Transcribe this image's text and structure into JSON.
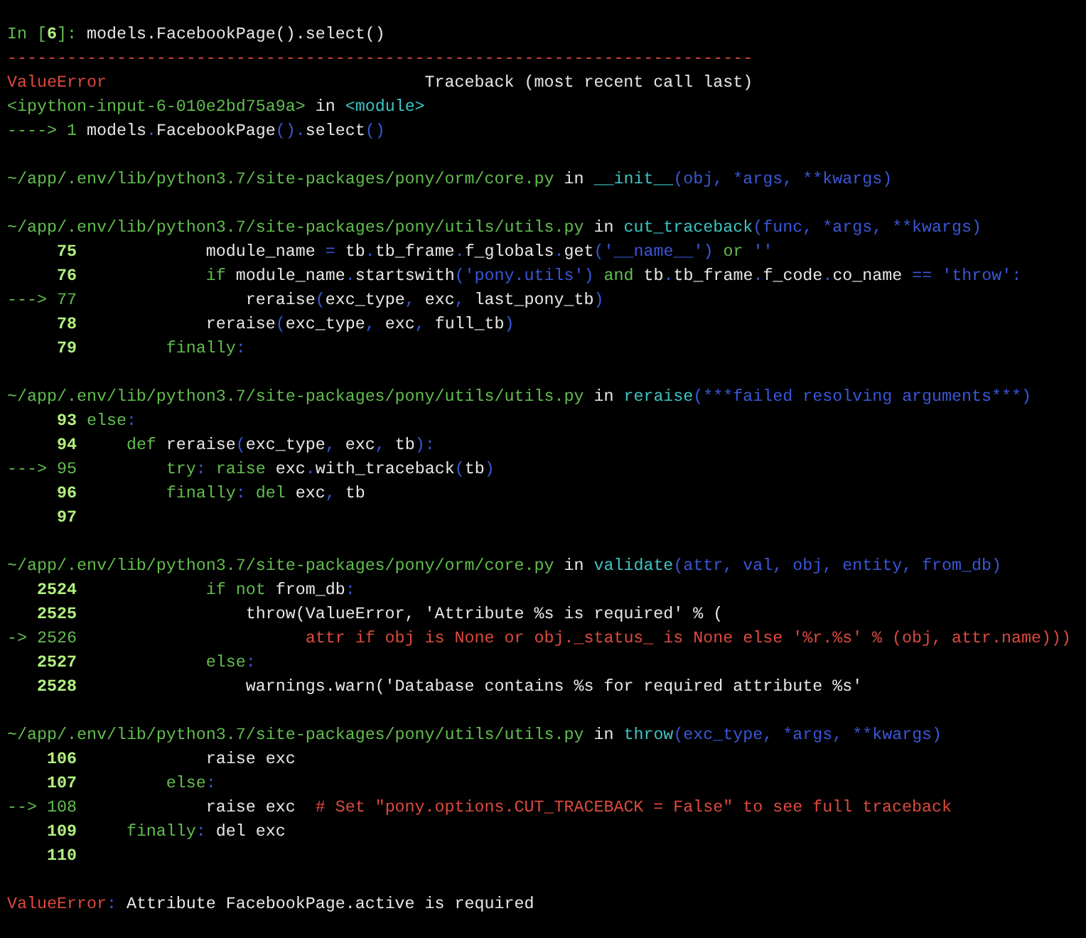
{
  "console": {
    "lines": [
      {
        "kind": "text",
        "segments": [
          {
            "kind": "green",
            "text": "In ["
          },
          {
            "kind": "num",
            "text": "6"
          },
          {
            "kind": "green",
            "text": "]: "
          },
          {
            "kind": "plain",
            "text": "models.FacebookPage().select()"
          }
        ]
      },
      {
        "kind": "text",
        "segments": [
          {
            "kind": "red",
            "text": "---------------------------------------------------------------------------"
          }
        ]
      },
      {
        "kind": "text",
        "segments": [
          {
            "kind": "red",
            "text": "ValueError"
          },
          {
            "kind": "plain",
            "text": "                                Traceback (most recent call last)"
          }
        ]
      },
      {
        "kind": "text",
        "segments": [
          {
            "kind": "green",
            "text": "<ipython-input-6-010e2bd75a9a>"
          },
          {
            "kind": "plain",
            "text": " in "
          },
          {
            "kind": "cyan",
            "text": "<module>"
          }
        ]
      },
      {
        "kind": "text",
        "segments": [
          {
            "kind": "green",
            "text": "----> 1 "
          },
          {
            "kind": "plain",
            "text": "models"
          },
          {
            "kind": "blue",
            "text": "."
          },
          {
            "kind": "plain",
            "text": "FacebookPage"
          },
          {
            "kind": "blue",
            "text": "()."
          },
          {
            "kind": "plain",
            "text": "select"
          },
          {
            "kind": "blue",
            "text": "()"
          }
        ]
      },
      {
        "kind": "blank"
      },
      {
        "kind": "text",
        "segments": [
          {
            "kind": "green",
            "text": "~/app/.env/lib/python3.7/site-packages/pony/orm/core.py"
          },
          {
            "kind": "plain",
            "text": " in "
          },
          {
            "kind": "cyan",
            "text": "__init__"
          },
          {
            "kind": "blue",
            "text": "(obj, *args, **kwargs)"
          }
        ]
      },
      {
        "kind": "blank"
      },
      {
        "kind": "text",
        "segments": [
          {
            "kind": "green",
            "text": "~/app/.env/lib/python3.7/site-packages/pony/utils/utils.py"
          },
          {
            "kind": "plain",
            "text": " in "
          },
          {
            "kind": "cyan",
            "text": "cut_traceback"
          },
          {
            "kind": "blue",
            "text": "(func, *args, **kwargs)"
          }
        ]
      },
      {
        "kind": "text",
        "segments": [
          {
            "kind": "num",
            "text": "     75"
          },
          {
            "kind": "plain",
            "text": "             module_name "
          },
          {
            "kind": "blue",
            "text": "="
          },
          {
            "kind": "plain",
            "text": " tb"
          },
          {
            "kind": "blue",
            "text": "."
          },
          {
            "kind": "plain",
            "text": "tb_frame"
          },
          {
            "kind": "blue",
            "text": "."
          },
          {
            "kind": "plain",
            "text": "f_globals"
          },
          {
            "kind": "blue",
            "text": "."
          },
          {
            "kind": "plain",
            "text": "get"
          },
          {
            "kind": "blue",
            "text": "('__name__')"
          },
          {
            "kind": "green",
            "text": " or "
          },
          {
            "kind": "blue",
            "text": "''"
          }
        ]
      },
      {
        "kind": "text",
        "segments": [
          {
            "kind": "num",
            "text": "     76"
          },
          {
            "kind": "green",
            "text": "             if"
          },
          {
            "kind": "plain",
            "text": " module_name"
          },
          {
            "kind": "blue",
            "text": "."
          },
          {
            "kind": "plain",
            "text": "startswith"
          },
          {
            "kind": "blue",
            "text": "('pony.utils')"
          },
          {
            "kind": "green",
            "text": " and"
          },
          {
            "kind": "plain",
            "text": " tb"
          },
          {
            "kind": "blue",
            "text": "."
          },
          {
            "kind": "plain",
            "text": "tb_frame"
          },
          {
            "kind": "blue",
            "text": "."
          },
          {
            "kind": "plain",
            "text": "f_code"
          },
          {
            "kind": "blue",
            "text": "."
          },
          {
            "kind": "plain",
            "text": "co_name "
          },
          {
            "kind": "blue",
            "text": "== 'throw':"
          }
        ]
      },
      {
        "kind": "text",
        "segments": [
          {
            "kind": "green",
            "text": "---> 77"
          },
          {
            "kind": "plain",
            "text": "                 reraise"
          },
          {
            "kind": "blue",
            "text": "("
          },
          {
            "kind": "plain",
            "text": "exc_type"
          },
          {
            "kind": "blue",
            "text": ","
          },
          {
            "kind": "plain",
            "text": " exc"
          },
          {
            "kind": "blue",
            "text": ","
          },
          {
            "kind": "plain",
            "text": " last_pony_tb"
          },
          {
            "kind": "blue",
            "text": ")"
          }
        ]
      },
      {
        "kind": "text",
        "segments": [
          {
            "kind": "num",
            "text": "     78"
          },
          {
            "kind": "plain",
            "text": "             reraise"
          },
          {
            "kind": "blue",
            "text": "("
          },
          {
            "kind": "plain",
            "text": "exc_type"
          },
          {
            "kind": "blue",
            "text": ","
          },
          {
            "kind": "plain",
            "text": " exc"
          },
          {
            "kind": "blue",
            "text": ","
          },
          {
            "kind": "plain",
            "text": " full_tb"
          },
          {
            "kind": "blue",
            "text": ")"
          }
        ]
      },
      {
        "kind": "text",
        "segments": [
          {
            "kind": "num",
            "text": "     79"
          },
          {
            "kind": "green",
            "text": "         finally"
          },
          {
            "kind": "blue",
            "text": ":"
          }
        ]
      },
      {
        "kind": "blank"
      },
      {
        "kind": "text",
        "segments": [
          {
            "kind": "green",
            "text": "~/app/.env/lib/python3.7/site-packages/pony/utils/utils.py"
          },
          {
            "kind": "plain",
            "text": " in "
          },
          {
            "kind": "cyan",
            "text": "reraise"
          },
          {
            "kind": "blue",
            "text": "(***failed resolving arguments***)"
          }
        ]
      },
      {
        "kind": "text",
        "segments": [
          {
            "kind": "num",
            "text": "     93"
          },
          {
            "kind": "green",
            "text": " else"
          },
          {
            "kind": "blue",
            "text": ":"
          }
        ]
      },
      {
        "kind": "text",
        "segments": [
          {
            "kind": "num",
            "text": "     94"
          },
          {
            "kind": "green",
            "text": "     def"
          },
          {
            "kind": "plain",
            "text": " reraise"
          },
          {
            "kind": "blue",
            "text": "("
          },
          {
            "kind": "plain",
            "text": "exc_type"
          },
          {
            "kind": "blue",
            "text": ","
          },
          {
            "kind": "plain",
            "text": " exc"
          },
          {
            "kind": "blue",
            "text": ","
          },
          {
            "kind": "plain",
            "text": " tb"
          },
          {
            "kind": "blue",
            "text": "):"
          }
        ]
      },
      {
        "kind": "text",
        "segments": [
          {
            "kind": "green",
            "text": "---> 95"
          },
          {
            "kind": "green",
            "text": "         try"
          },
          {
            "kind": "blue",
            "text": ":"
          },
          {
            "kind": "green",
            "text": " raise"
          },
          {
            "kind": "plain",
            "text": " exc"
          },
          {
            "kind": "blue",
            "text": "."
          },
          {
            "kind": "plain",
            "text": "with_traceback"
          },
          {
            "kind": "blue",
            "text": "("
          },
          {
            "kind": "plain",
            "text": "tb"
          },
          {
            "kind": "blue",
            "text": ")"
          }
        ]
      },
      {
        "kind": "text",
        "segments": [
          {
            "kind": "num",
            "text": "     96"
          },
          {
            "kind": "green",
            "text": "         finally"
          },
          {
            "kind": "blue",
            "text": ":"
          },
          {
            "kind": "green",
            "text": " del"
          },
          {
            "kind": "plain",
            "text": " exc"
          },
          {
            "kind": "blue",
            "text": ","
          },
          {
            "kind": "plain",
            "text": " tb"
          }
        ]
      },
      {
        "kind": "text",
        "segments": [
          {
            "kind": "num",
            "text": "     97"
          }
        ]
      },
      {
        "kind": "blank"
      },
      {
        "kind": "text",
        "segments": [
          {
            "kind": "green",
            "text": "~/app/.env/lib/python3.7/site-packages/pony/orm/core.py"
          },
          {
            "kind": "plain",
            "text": " in "
          },
          {
            "kind": "cyan",
            "text": "validate"
          },
          {
            "kind": "blue",
            "text": "(attr, val, obj, entity, from_db)"
          }
        ]
      },
      {
        "kind": "text",
        "segments": [
          {
            "kind": "num",
            "text": "   2524"
          },
          {
            "kind": "green",
            "text": "             if not"
          },
          {
            "kind": "plain",
            "text": " from_db"
          },
          {
            "kind": "blue",
            "text": ":"
          }
        ]
      },
      {
        "kind": "text",
        "segments": [
          {
            "kind": "num",
            "text": "   2525"
          },
          {
            "kind": "plain",
            "text": "                 throw(ValueError, 'Attribute %s is required' % ("
          }
        ]
      },
      {
        "kind": "text",
        "segments": [
          {
            "kind": "green",
            "text": "-> 2526"
          },
          {
            "kind": "red",
            "text": "                       attr if obj is None or obj._status_ is None else '%r.%s' % (obj, attr.name)))"
          }
        ]
      },
      {
        "kind": "text",
        "segments": [
          {
            "kind": "num",
            "text": "   2527"
          },
          {
            "kind": "green",
            "text": "             else"
          },
          {
            "kind": "blue",
            "text": ":"
          }
        ]
      },
      {
        "kind": "text",
        "segments": [
          {
            "kind": "num",
            "text": "   2528"
          },
          {
            "kind": "plain",
            "text": "                 warnings.warn('Database contains %s for required attribute %s'"
          }
        ]
      },
      {
        "kind": "blank"
      },
      {
        "kind": "text",
        "segments": [
          {
            "kind": "green",
            "text": "~/app/.env/lib/python3.7/site-packages/pony/utils/utils.py"
          },
          {
            "kind": "plain",
            "text": " in "
          },
          {
            "kind": "cyan",
            "text": "throw"
          },
          {
            "kind": "blue",
            "text": "(exc_type, *args, **kwargs)"
          }
        ]
      },
      {
        "kind": "text",
        "segments": [
          {
            "kind": "num",
            "text": "    106"
          },
          {
            "kind": "plain",
            "text": "             raise exc"
          }
        ]
      },
      {
        "kind": "text",
        "segments": [
          {
            "kind": "num",
            "text": "    107"
          },
          {
            "kind": "green",
            "text": "         else"
          },
          {
            "kind": "blue",
            "text": ":"
          }
        ]
      },
      {
        "kind": "text",
        "segments": [
          {
            "kind": "green",
            "text": "--> 108"
          },
          {
            "kind": "plain",
            "text": "             raise exc"
          },
          {
            "kind": "red",
            "text": "  # Set \"pony.options.CUT_TRACEBACK = False\" to see full traceback"
          }
        ]
      },
      {
        "kind": "text",
        "segments": [
          {
            "kind": "num",
            "text": "    109"
          },
          {
            "kind": "green",
            "text": "     finally"
          },
          {
            "kind": "blue",
            "text": ":"
          },
          {
            "kind": "plain",
            "text": " del exc"
          }
        ]
      },
      {
        "kind": "text",
        "segments": [
          {
            "kind": "num",
            "text": "    110"
          }
        ]
      },
      {
        "kind": "blank"
      },
      {
        "kind": "text",
        "segments": [
          {
            "kind": "red",
            "text": "ValueError"
          },
          {
            "kind": "blue",
            "text": ":"
          },
          {
            "kind": "plain",
            "text": " Attribute FacebookPage.active is required"
          }
        ]
      }
    ]
  }
}
